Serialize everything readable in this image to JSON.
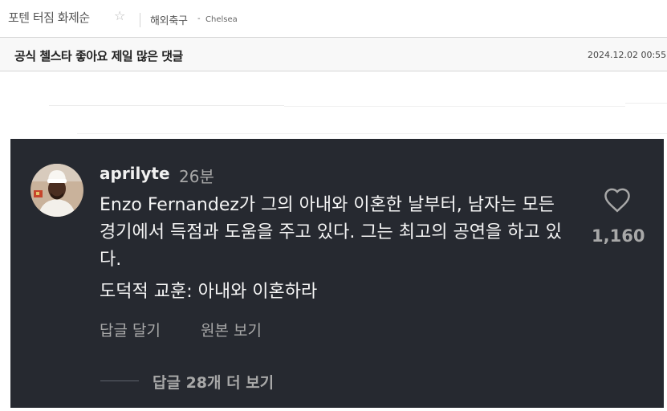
{
  "header": {
    "sort_label": "포텐 터짐 화제순",
    "star_icon": "☆",
    "board_name": "해외축구",
    "separator": "-",
    "team": "Chelsea"
  },
  "post": {
    "title": "공식 첼스타 좋아요 제일 많은 댓글",
    "date": "2024.12.02 00:55"
  },
  "comment": {
    "username": "aprilyte",
    "time_ago": "26분",
    "body": "Enzo Fernandez가 그의 아내와 이혼한 날부터, 남자는 모든 경기에서 득점과 도움을 주고 있다. 그는 최고의 공연을 하고 있다.",
    "moral": "도덕적 교훈: 아내와 이혼하라",
    "reply_label": "답글 달기",
    "original_label": "원본 보기",
    "like_icon": "heart-outline-icon",
    "like_count": "1,160",
    "view_replies": "답글 28개 더 보기"
  },
  "colors": {
    "panel_bg": "#262930",
    "text_primary": "#f5f5f5",
    "text_secondary": "#a8a8a8"
  }
}
